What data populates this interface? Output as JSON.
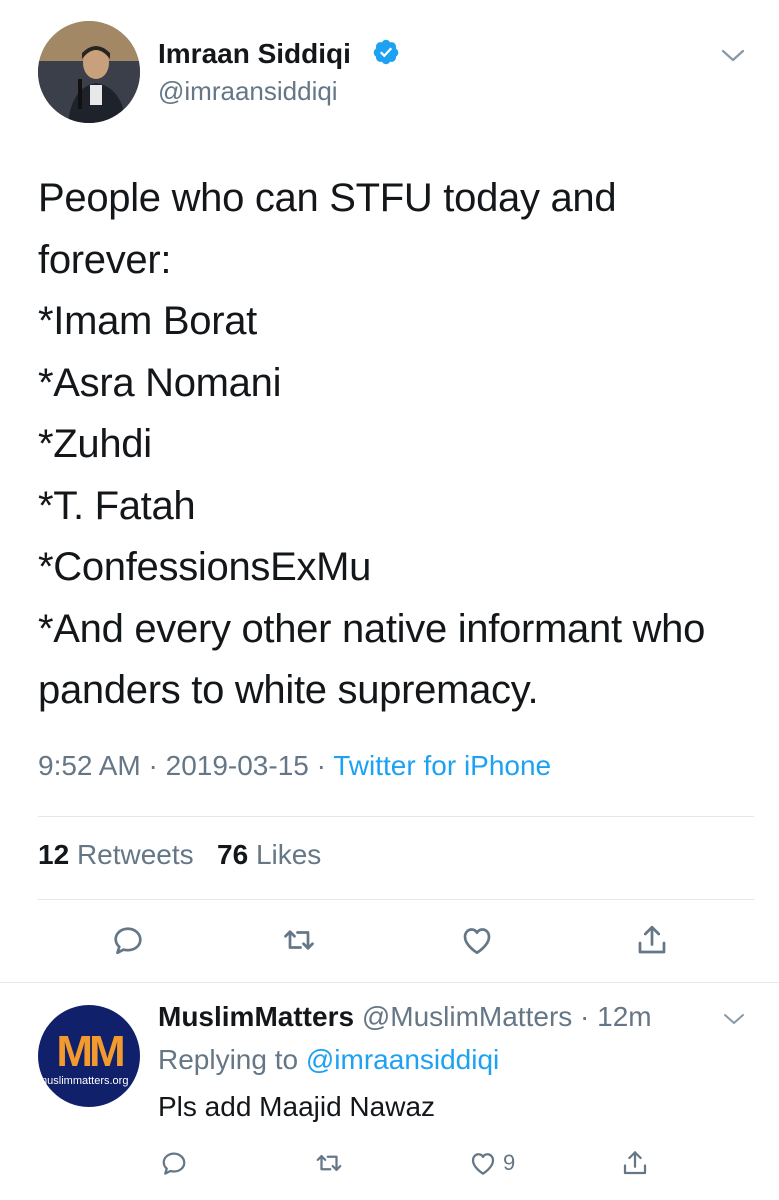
{
  "tweet": {
    "author_name": "Imraan Siddiqi",
    "author_handle": "@imraansiddiqi",
    "verified": true,
    "text": "People who can STFU today and\nforever:\n*Imam Borat\n*Asra Nomani\n*Zuhdi\n*T. Fatah\n*ConfessionsExMu\n*And every other native informant who\npanders to white supremacy.",
    "time": "9:52 AM",
    "date": "2019-03-15",
    "source": "Twitter for iPhone",
    "retweets_count": "12",
    "retweets_label": "Retweets",
    "likes_count": "76",
    "likes_label": "Likes"
  },
  "reply": {
    "author_name": "MuslimMatters",
    "author_handle": "@MuslimMatters",
    "time_ago": "12m",
    "replying_label": "Replying to",
    "replying_handle": "@imraansiddiqi",
    "text": "Pls add Maajid Nawaz",
    "like_count": "9",
    "avatar_logo": "MM",
    "avatar_site": "muslimmatters.org"
  },
  "colors": {
    "text": "#14171a",
    "secondary": "#657786",
    "accent": "#1da1f2",
    "divider": "#e1e8ed"
  },
  "icons": [
    "verified-badge-icon",
    "chevron-down-icon",
    "reply-icon",
    "retweet-icon",
    "like-icon",
    "share-icon"
  ]
}
